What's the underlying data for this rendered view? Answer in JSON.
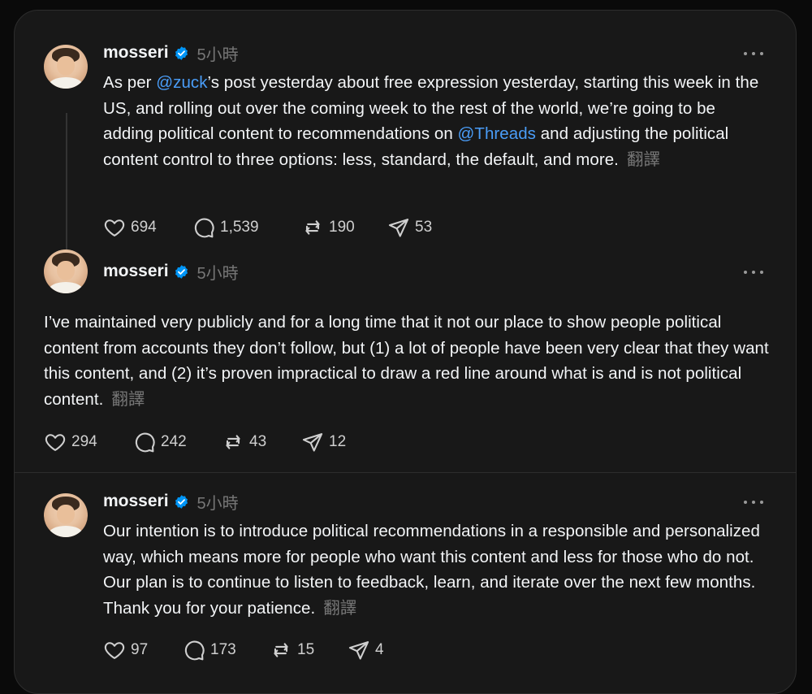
{
  "posts": [
    {
      "username": "mosseri",
      "time": "5小時",
      "body_parts": [
        "As per ",
        "@zuck",
        "’s post yesterday about free expression yesterday, starting this week in the US, and rolling out over the coming week to the rest of the world, we’re going to be adding political content to recommendations on ",
        "@Threads",
        " and adjusting the political content control to three options: less, standard, the default, and more."
      ],
      "translate": "翻譯",
      "likes": "694",
      "replies": "1,539",
      "reposts": "190",
      "shares": "53"
    },
    {
      "username": "mosseri",
      "time": "5小時",
      "body": "I’ve maintained very publicly and for a long time that it not our place to show people political content from accounts they don’t follow, but (1) a lot of people have been very clear that they want this content, and (2) it’s proven impractical to draw a red line around what is and is not political content.",
      "translate": "翻譯",
      "likes": "294",
      "replies": "242",
      "reposts": "43",
      "shares": "12"
    },
    {
      "username": "mosseri",
      "time": "5小時",
      "body": "Our intention is to introduce political recommendations in a responsible and personalized way, which means more for people who want this content and less for those who do not. Our plan is to continue to listen to feedback, learn, and iterate over the next few months. Thank you for your patience.",
      "translate": "翻譯",
      "likes": "97",
      "replies": "173",
      "reposts": "15",
      "shares": "4"
    }
  ],
  "icons": {
    "verified": "verified-badge-icon",
    "like": "heart-icon",
    "reply": "comment-icon",
    "repost": "repost-icon",
    "share": "send-icon",
    "more": "more-dots-icon"
  },
  "colors": {
    "background": "#181818",
    "mention": "#4a9df8",
    "verified": "#0095f6",
    "muted": "#777777"
  }
}
